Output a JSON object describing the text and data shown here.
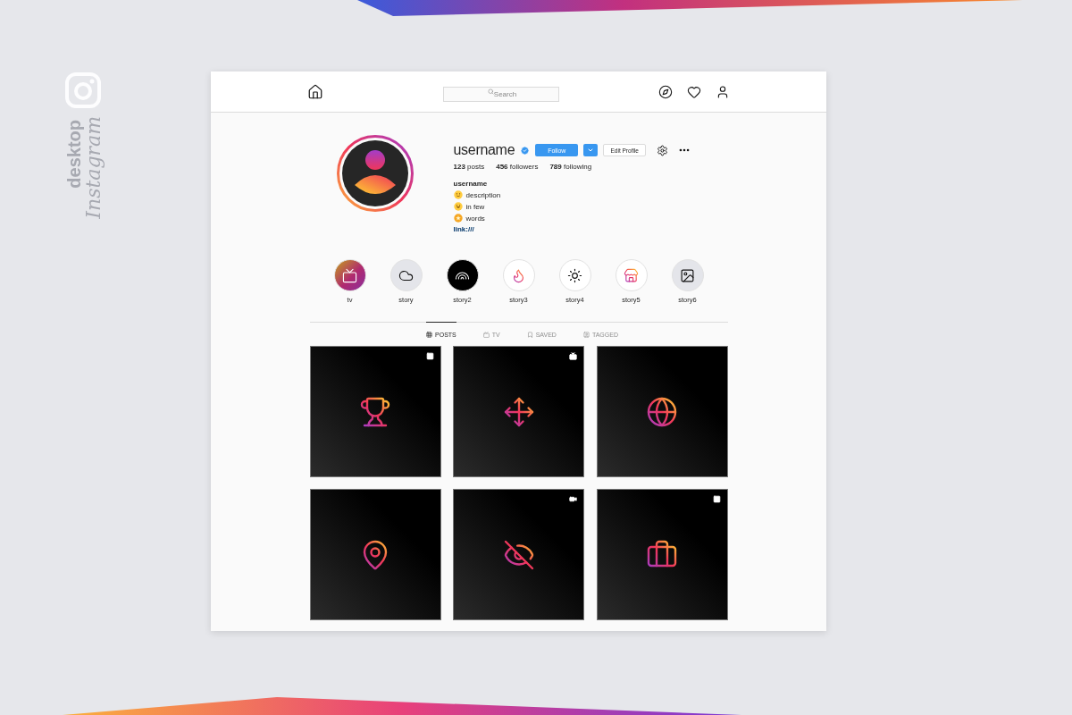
{
  "branding": {
    "line_1": "desktop",
    "line_2": "Instagram"
  },
  "nav": {
    "search": {
      "placeholder": "Search"
    }
  },
  "profile": {
    "username": "username",
    "verified": true,
    "follow": "Follow",
    "edit": "Edit Profile",
    "stats": [
      {
        "count": "123",
        "label": "posts"
      },
      {
        "count": "456",
        "label": "followers"
      },
      {
        "count": "789",
        "label": "following"
      }
    ],
    "bio": {
      "name": "username",
      "lines": [
        {
          "kind": "wink",
          "text": "description"
        },
        {
          "kind": "laugh",
          "text": "in few"
        },
        {
          "kind": "star",
          "text": "words"
        }
      ],
      "link": "link:///"
    }
  },
  "stories": [
    {
      "label": "tv",
      "kind": "tv"
    },
    {
      "label": "story",
      "kind": "cloud"
    },
    {
      "label": "story2",
      "kind": "rainbow"
    },
    {
      "label": "story3",
      "kind": "flame"
    },
    {
      "label": "story4",
      "kind": "sun"
    },
    {
      "label": "story5",
      "kind": "store"
    },
    {
      "label": "story6",
      "kind": "image"
    }
  ],
  "tabs": [
    {
      "label": "POSTS",
      "kind": "grid",
      "selected": true
    },
    {
      "label": "TV",
      "kind": "tv",
      "selected": false
    },
    {
      "label": "SAVED",
      "kind": "bookmark",
      "selected": false
    },
    {
      "label": "TAGGED",
      "kind": "tag",
      "selected": false
    }
  ],
  "posts": [
    {
      "kind": "trophy",
      "overlay": {
        "kind": "carousel"
      }
    },
    {
      "kind": "move",
      "overlay": {
        "kind": "tv"
      }
    },
    {
      "kind": "globe"
    },
    {
      "kind": "pin"
    },
    {
      "kind": "eye-off",
      "overlay": {
        "kind": "video"
      }
    },
    {
      "kind": "briefcase",
      "overlay": {
        "kind": "carousel"
      }
    }
  ]
}
